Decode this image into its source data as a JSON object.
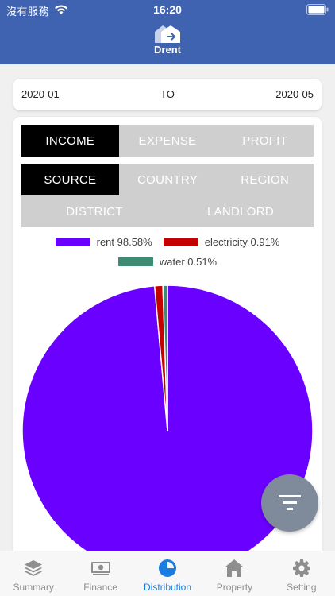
{
  "status_bar": {
    "carrier": "沒有服務",
    "time": "16:20"
  },
  "app": {
    "name": "Drent"
  },
  "date_range": {
    "start": "2020-01",
    "separator": "TO",
    "end": "2020-05"
  },
  "type_tabs": [
    {
      "label": "INCOME",
      "active": true
    },
    {
      "label": "EXPENSE",
      "active": false
    },
    {
      "label": "PROFIT",
      "active": false
    }
  ],
  "dimension_tabs_row1": [
    {
      "label": "SOURCE",
      "active": true
    },
    {
      "label": "COUNTRY",
      "active": false
    },
    {
      "label": "REGION",
      "active": false
    }
  ],
  "dimension_tabs_row2": [
    {
      "label": "DISTRICT",
      "active": false
    },
    {
      "label": "LANDLORD",
      "active": false
    }
  ],
  "legend": [
    {
      "label": "rent 98.58%",
      "color": "#6a00ff"
    },
    {
      "label": "electricity 0.91%",
      "color": "#c40000"
    },
    {
      "label": "water 0.51%",
      "color": "#3f8a72"
    }
  ],
  "chart_data": {
    "type": "pie",
    "slices": [
      {
        "name": "rent",
        "percent": 98.58,
        "color": "#6a00ff"
      },
      {
        "name": "electricity",
        "percent": 0.91,
        "color": "#c40000"
      },
      {
        "name": "water",
        "percent": 0.51,
        "color": "#3f8a72"
      }
    ]
  },
  "tabbar": [
    {
      "label": "Summary",
      "icon": "layers-icon",
      "active": false
    },
    {
      "label": "Finance",
      "icon": "banknote-icon",
      "active": false
    },
    {
      "label": "Distribution",
      "icon": "pie-chart-icon",
      "active": true
    },
    {
      "label": "Property",
      "icon": "house-icon",
      "active": false
    },
    {
      "label": "Setting",
      "icon": "gear-icon",
      "active": false
    }
  ],
  "colors": {
    "header": "#3f63b0",
    "active_tab": "#1a7be0",
    "fab": "#7f8a9b"
  }
}
